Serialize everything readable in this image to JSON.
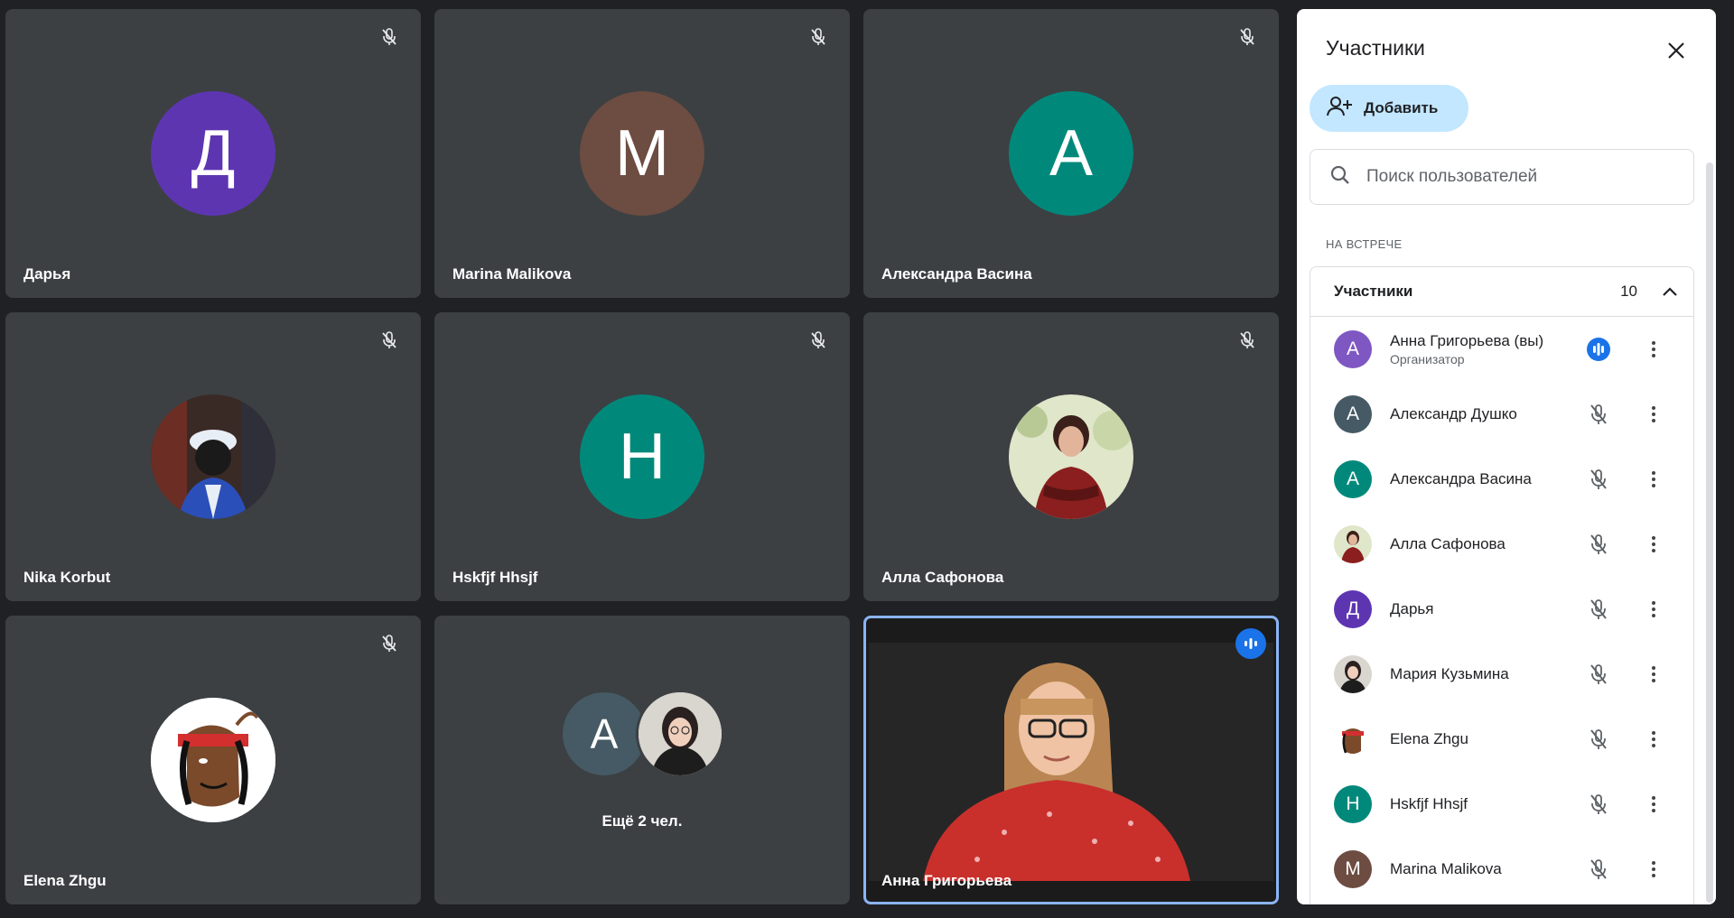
{
  "tiles": [
    {
      "name": "Дарья",
      "initial": "Д",
      "color": "#5e35b1"
    },
    {
      "name": "Marina Malikova",
      "initial": "M",
      "color": "#6d4c41"
    },
    {
      "name": "Александра Васина",
      "initial": "А",
      "color": "#00897b"
    },
    {
      "name": "Nika Korbut"
    },
    {
      "name": "Hskfjf Hhsjf",
      "initial": "H",
      "color": "#00897b"
    },
    {
      "name": "Алла Сафонова"
    },
    {
      "name": "Elena Zhgu"
    },
    {
      "more_label": "Ещё 2 чел.",
      "initial": "А",
      "color": "#455a64"
    },
    {
      "name": "Анна Григорьева"
    }
  ],
  "panel": {
    "title": "Участники",
    "add_label": "Добавить",
    "search_placeholder": "Поиск пользователей",
    "section_label": "НА ВСТРЕЧЕ",
    "group_title": "Участники",
    "group_count": "10",
    "participants": [
      {
        "name": "Анна Григорьева (вы)",
        "role": "Организатор",
        "initial": "А",
        "color": "#7e57c2"
      },
      {
        "name": "Александр Душко",
        "initial": "А",
        "color": "#455a64"
      },
      {
        "name": "Александра Васина",
        "initial": "А",
        "color": "#00897b"
      },
      {
        "name": "Алла Сафонова"
      },
      {
        "name": "Дарья",
        "initial": "Д",
        "color": "#5e35b1"
      },
      {
        "name": "Мария Кузьмина"
      },
      {
        "name": "Elena Zhgu"
      },
      {
        "name": "Hskfjf Hhsjf",
        "initial": "H",
        "color": "#00897b"
      },
      {
        "name": "Marina Malikova",
        "initial": "M",
        "color": "#6d4c41"
      }
    ]
  },
  "colors": {
    "accent": "#1a73e8",
    "tile_bg": "#3c4043",
    "page_bg": "#202124",
    "add_button": "#c2e7ff"
  }
}
